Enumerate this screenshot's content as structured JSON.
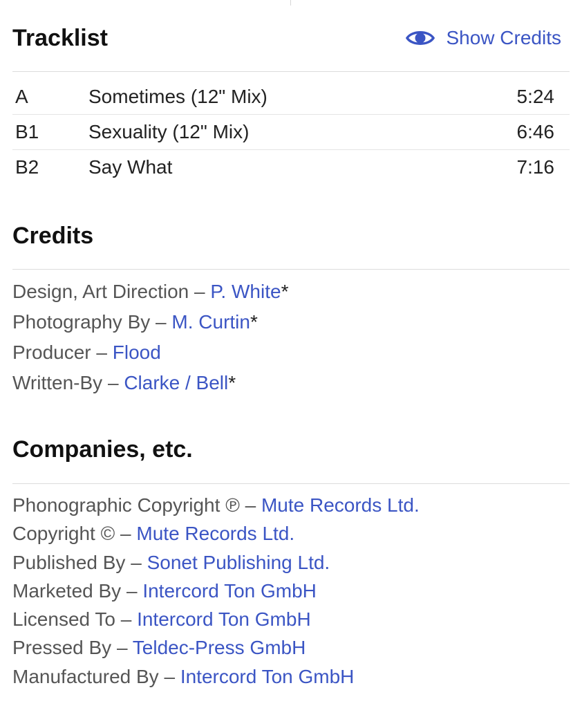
{
  "tracklist": {
    "title": "Tracklist",
    "show_credits_label": "Show Credits",
    "tracks": [
      {
        "position": "A",
        "title": "Sometimes (12\" Mix)",
        "duration": "5:24"
      },
      {
        "position": "B1",
        "title": "Sexuality (12\" Mix)",
        "duration": "6:46"
      },
      {
        "position": "B2",
        "title": "Say What",
        "duration": "7:16"
      }
    ]
  },
  "credits": {
    "title": "Credits",
    "items": [
      {
        "role": "Design, Art Direction",
        "separator": " – ",
        "name": "P. White",
        "suffix": "*"
      },
      {
        "role": "Photography By",
        "separator": " – ",
        "name": "M. Curtin",
        "suffix": "*"
      },
      {
        "role": "Producer",
        "separator": " – ",
        "name": "Flood",
        "suffix": ""
      },
      {
        "role": "Written-By",
        "separator": " – ",
        "name": "Clarke / Bell",
        "suffix": "*"
      }
    ]
  },
  "companies": {
    "title": "Companies, etc.",
    "items": [
      {
        "role": "Phonographic Copyright ℗",
        "separator": " – ",
        "name": "Mute Records Ltd."
      },
      {
        "role": "Copyright ©",
        "separator": " – ",
        "name": "Mute Records Ltd."
      },
      {
        "role": "Published By",
        "separator": " – ",
        "name": "Sonet Publishing Ltd."
      },
      {
        "role": "Marketed By",
        "separator": " – ",
        "name": "Intercord Ton GmbH"
      },
      {
        "role": "Licensed To",
        "separator": " – ",
        "name": "Intercord Ton GmbH"
      },
      {
        "role": "Pressed By",
        "separator": " – ",
        "name": "Teldec-Press GmbH"
      },
      {
        "role": "Manufactured By",
        "separator": " – ",
        "name": "Intercord Ton GmbH"
      }
    ]
  },
  "colors": {
    "link": "#3b55c4",
    "text": "#1a1a1a",
    "muted": "#555555",
    "divider": "#dcdcdc"
  },
  "icons": {
    "show_credits": "eye-icon"
  }
}
